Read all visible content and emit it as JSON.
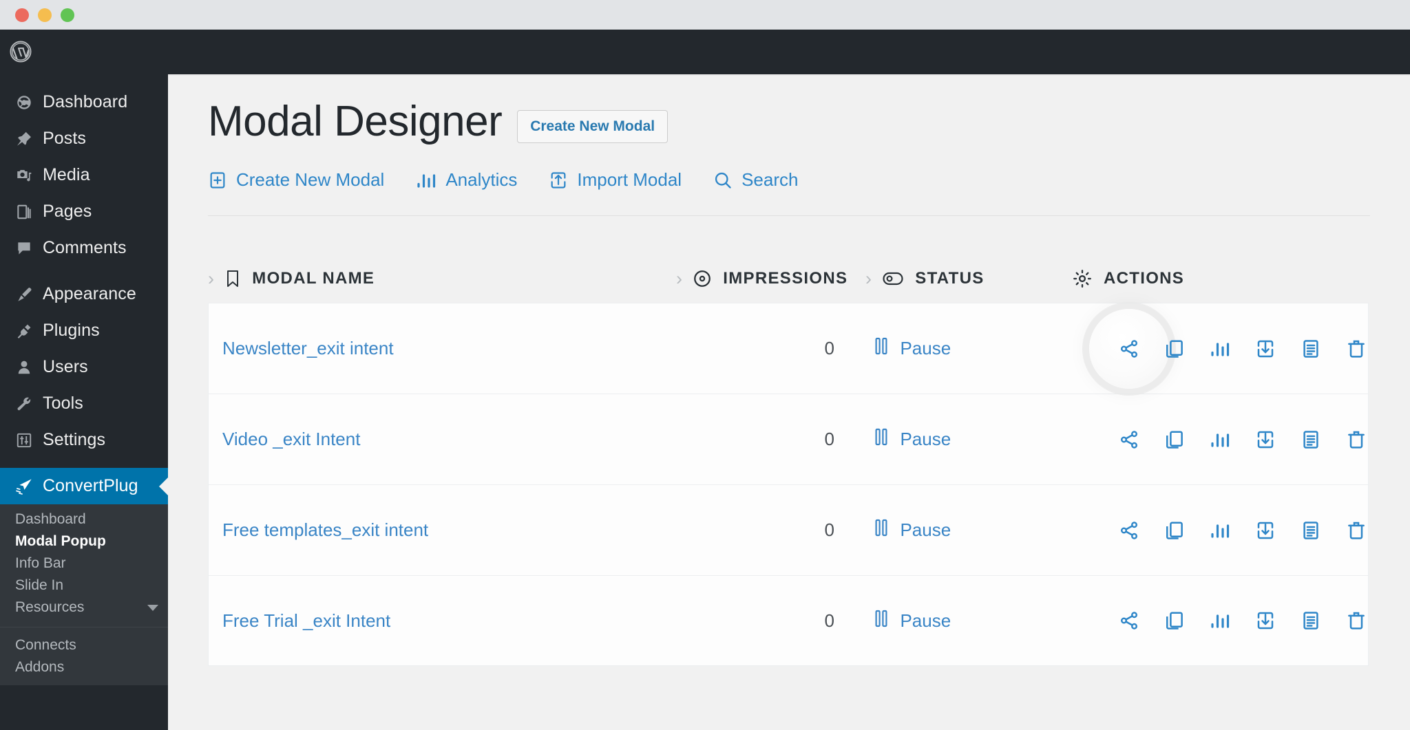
{
  "window": {
    "traffic_lights": [
      "close",
      "minimize",
      "maximize"
    ]
  },
  "adminbar": {
    "logo": "wordpress-logo-icon"
  },
  "sidebar": {
    "items": [
      {
        "label": "Dashboard",
        "icon": "dashboard-icon",
        "current": false
      },
      {
        "label": "Posts",
        "icon": "pin-icon",
        "current": false
      },
      {
        "label": "Media",
        "icon": "camera-icon",
        "current": false
      },
      {
        "label": "Pages",
        "icon": "page-icon",
        "current": false
      },
      {
        "label": "Comments",
        "icon": "comment-icon",
        "current": false
      },
      {
        "label": "Appearance",
        "icon": "brush-icon",
        "current": false
      },
      {
        "label": "Plugins",
        "icon": "plug-icon",
        "current": false
      },
      {
        "label": "Users",
        "icon": "user-icon",
        "current": false
      },
      {
        "label": "Tools",
        "icon": "wrench-icon",
        "current": false
      },
      {
        "label": "Settings",
        "icon": "sliders-icon",
        "current": false
      },
      {
        "label": "ConvertPlug",
        "icon": "convertplug-icon",
        "current": true
      }
    ],
    "submenu": [
      {
        "label": "Dashboard",
        "active": false,
        "caret": false
      },
      {
        "label": "Modal Popup",
        "active": true,
        "caret": false
      },
      {
        "label": "Info Bar",
        "active": false,
        "caret": false
      },
      {
        "label": "Slide In",
        "active": false,
        "caret": false
      },
      {
        "label": "Resources",
        "active": false,
        "caret": true
      }
    ],
    "submenu_bottom": [
      {
        "label": "Connects",
        "active": false,
        "caret": false
      },
      {
        "label": "Addons",
        "active": false,
        "caret": false
      }
    ],
    "highlight_color": "#0073aa"
  },
  "page": {
    "title": "Modal Designer",
    "create_button": "Create New Modal"
  },
  "action_links": [
    {
      "label": "Create New Modal",
      "icon": "plus-box-icon"
    },
    {
      "label": "Analytics",
      "icon": "bar-chart-icon"
    },
    {
      "label": "Import Modal",
      "icon": "upload-box-icon"
    },
    {
      "label": "Search",
      "icon": "search-icon"
    }
  ],
  "table": {
    "columns": [
      {
        "label": "MODAL NAME",
        "icon": "bookmark-icon",
        "chevron": true
      },
      {
        "label": "IMPRESSIONS",
        "icon": "target-icon",
        "chevron": true
      },
      {
        "label": "STATUS",
        "icon": "toggle-icon",
        "chevron": true
      },
      {
        "label": "ACTIONS",
        "icon": "gear-icon",
        "chevron": false
      }
    ],
    "row_actions": [
      {
        "name": "share-icon",
        "title": "Share"
      },
      {
        "name": "duplicate-icon",
        "title": "Duplicate"
      },
      {
        "name": "stats-icon",
        "title": "Analytics"
      },
      {
        "name": "export-icon",
        "title": "Export"
      },
      {
        "name": "document-icon",
        "title": "Details"
      },
      {
        "name": "trash-icon",
        "title": "Delete"
      }
    ],
    "rows": [
      {
        "name": "Newsletter_exit intent",
        "impressions": "0",
        "status": "Pause",
        "highlight_share": true
      },
      {
        "name": "Video _exit Intent",
        "impressions": "0",
        "status": "Pause",
        "highlight_share": false
      },
      {
        "name": "Free templates_exit intent",
        "impressions": "0",
        "status": "Pause",
        "highlight_share": false
      },
      {
        "name": "Free Trial _exit Intent",
        "impressions": "0",
        "status": "Pause",
        "highlight_share": false
      }
    ]
  },
  "colors": {
    "accent_blue": "#2e86c8",
    "link_blue": "#3a85c6",
    "admin_dark": "#23282d",
    "submenu_dark": "#32373c",
    "current_blue": "#0073aa",
    "content_bg": "#f1f1f1",
    "row_bg": "#fdfdfd"
  }
}
